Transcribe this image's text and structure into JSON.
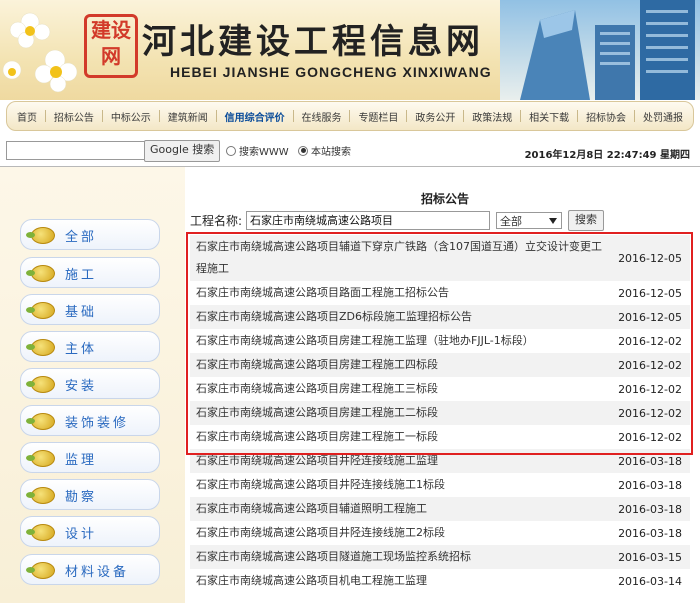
{
  "banner": {
    "stamp_text": "建设网",
    "title_cn": "河北建设工程信息网",
    "title_en": "HEBEI JIANSHE GONGCHENG XINXIWANG"
  },
  "nav": [
    {
      "label": "首页",
      "active": false
    },
    {
      "label": "招标公告",
      "active": false
    },
    {
      "label": "中标公示",
      "active": false
    },
    {
      "label": "建筑新闻",
      "active": false
    },
    {
      "label": "信用综合评价",
      "active": true
    },
    {
      "label": "在线服务",
      "active": false
    },
    {
      "label": "专题栏目",
      "active": false
    },
    {
      "label": "政务公开",
      "active": false
    },
    {
      "label": "政策法规",
      "active": false
    },
    {
      "label": "相关下载",
      "active": false
    },
    {
      "label": "招标协会",
      "active": false
    },
    {
      "label": "处罚通报",
      "active": false
    }
  ],
  "search": {
    "query_value": "",
    "google_button": "Google 搜索",
    "radio_www": "搜索WWW",
    "radio_site": "本站搜索",
    "selected": "site",
    "datetime": "2016年12月8日 22:47:49 星期四"
  },
  "sidebar": {
    "items": [
      "全部",
      "施工",
      "基础",
      "主体",
      "安装",
      "装饰装修",
      "监理",
      "勘察",
      "设计",
      "材料设备"
    ]
  },
  "main": {
    "title": "招标公告",
    "filter_label": "工程名称:",
    "filter_value": "石家庄市南绕城高速公路项目",
    "category_value": "全部",
    "search_button": "搜索",
    "rows": [
      {
        "title": "石家庄市南绕城高速公路项目辅道下穿京广铁路（含107国道互通）立交设计变更工程施工",
        "date": "2016-12-05"
      },
      {
        "title": "石家庄市南绕城高速公路项目路面工程施工招标公告",
        "date": "2016-12-05"
      },
      {
        "title": "石家庄市南绕城高速公路项目ZD6标段施工监理招标公告",
        "date": "2016-12-05"
      },
      {
        "title": "石家庄市南绕城高速公路项目房建工程施工监理（驻地办FJJL-1标段）",
        "date": "2016-12-02"
      },
      {
        "title": "石家庄市南绕城高速公路项目房建工程施工四标段",
        "date": "2016-12-02"
      },
      {
        "title": "石家庄市南绕城高速公路项目房建工程施工三标段",
        "date": "2016-12-02"
      },
      {
        "title": "石家庄市南绕城高速公路项目房建工程施工二标段",
        "date": "2016-12-02"
      },
      {
        "title": "石家庄市南绕城高速公路项目房建工程施工一标段",
        "date": "2016-12-02"
      },
      {
        "title": "石家庄市南绕城高速公路项目井陉连接线施工监理",
        "date": "2016-03-18"
      },
      {
        "title": "石家庄市南绕城高速公路项目井陉连接线施工1标段",
        "date": "2016-03-18"
      },
      {
        "title": "石家庄市南绕城高速公路项目辅道照明工程施工",
        "date": "2016-03-18"
      },
      {
        "title": "石家庄市南绕城高速公路项目井陉连接线施工2标段",
        "date": "2016-03-18"
      },
      {
        "title": "石家庄市南绕城高速公路项目隧道施工现场监控系统招标",
        "date": "2016-03-15"
      },
      {
        "title": "石家庄市南绕城高速公路项目机电工程施工监理",
        "date": "2016-03-14"
      }
    ]
  },
  "colors": {
    "highlight_border": "#e02020",
    "nav_active": "#0a4c9a",
    "sidebar_label": "#2a6ac0"
  }
}
